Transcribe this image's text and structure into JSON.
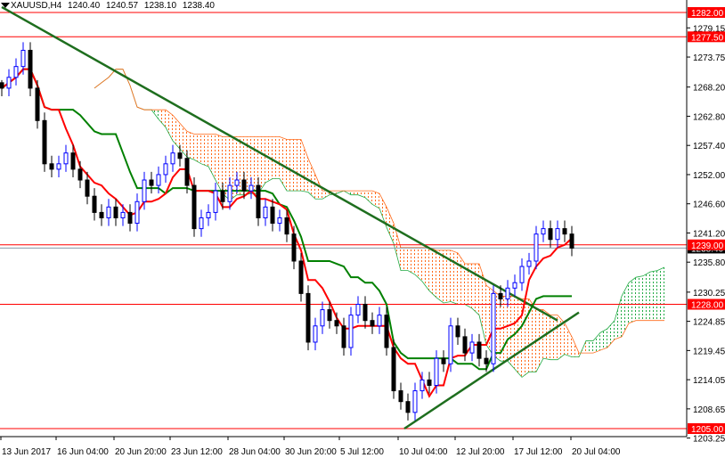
{
  "header": {
    "symbol": "XAUUSD,H4",
    "open": "1240.40",
    "high": "1240.57",
    "low": "1238.10",
    "close": "1238.40"
  },
  "colors": {
    "level_line": "#ff0000",
    "tenkan": "#ff0000",
    "kijun": "#008000",
    "trendline": "#1e6e1e",
    "cloud_bear": "#ff6a1a",
    "cloud_bull": "#22aa44",
    "bull_candle": "#0000ff",
    "bear_candle": "#000000",
    "bid_line": "#8899aa"
  },
  "chart_data": {
    "type": "candlestick",
    "title": "XAUUSD,H4",
    "ylim": [
      1202,
      1284
    ],
    "y_ticks": [
      "1279.15",
      "1273.75",
      "1268.20",
      "1262.80",
      "1257.40",
      "1252.00",
      "1246.60",
      "1241.20",
      "1235.80",
      "1230.25",
      "1224.85",
      "1219.45",
      "1214.05",
      "1208.65",
      "1203.25"
    ],
    "x_ticks": [
      "13 Jun 2017",
      "16 Jun 04:00",
      "20 Jun 20:00",
      "23 Jun 12:00",
      "28 Jun 04:00",
      "30 Jun 20:00",
      "5 Jul 12:00",
      "10 Jul 04:00",
      "12 Jul 20:00",
      "17 Jul 12:00",
      "20 Jul 04:00"
    ],
    "levels": [
      {
        "label": "1282.00",
        "value": 1282.0
      },
      {
        "label": "1277.50",
        "value": 1277.5
      },
      {
        "label": "1239.00",
        "value": 1239.0
      },
      {
        "label": "1228.00",
        "value": 1228.0
      },
      {
        "label": "1205.00",
        "value": 1205.0
      }
    ],
    "current_price": {
      "label": "1238.40",
      "value": 1238.4
    },
    "trendlines": [
      {
        "name": "descending",
        "from": [
          0,
          1283
        ],
        "to": [
          78,
          1225
        ]
      },
      {
        "name": "ascending",
        "from": [
          56.5,
          1205
        ],
        "to": [
          81,
          1226.5
        ]
      }
    ],
    "closes": [
      1268,
      1270,
      1272,
      1275,
      1268,
      1262,
      1254,
      1253,
      1254,
      1256,
      1253,
      1251,
      1248,
      1245,
      1244,
      1246,
      1244,
      1245,
      1243,
      1247,
      1251,
      1250,
      1252,
      1254,
      1256,
      1255,
      1250,
      1242,
      1244,
      1245,
      1249,
      1247,
      1250,
      1251,
      1249,
      1250,
      1244,
      1246,
      1243,
      1244,
      1241,
      1236,
      1230,
      1221,
      1224,
      1227,
      1225,
      1224,
      1220,
      1226,
      1228,
      1225,
      1224,
      1226,
      1220,
      1212,
      1210,
      1208,
      1212,
      1214,
      1213,
      1218,
      1217,
      1224,
      1222,
      1219,
      1221,
      1218,
      1217,
      1230,
      1229,
      1231,
      1232,
      1235,
      1236,
      1241,
      1242,
      1240,
      1242,
      1241,
      1238.4
    ]
  }
}
